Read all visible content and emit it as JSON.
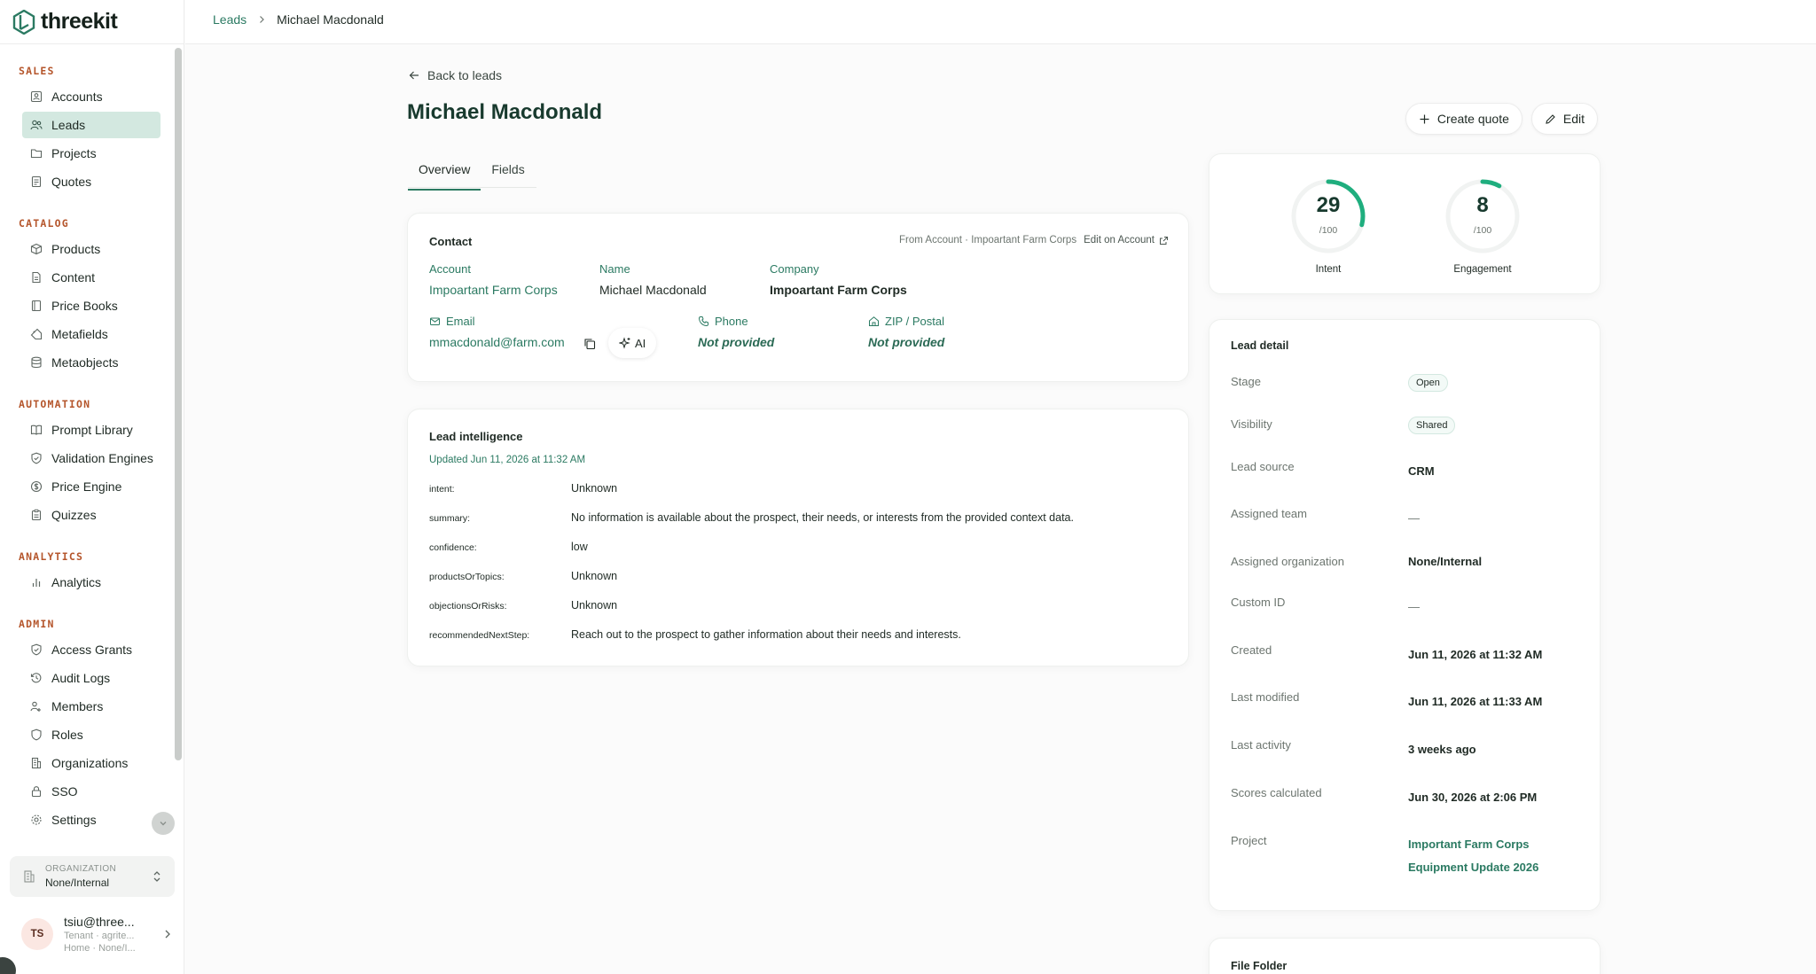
{
  "app": {
    "brand": "threekit"
  },
  "sidebar": {
    "sections": [
      {
        "title": "SALES",
        "items": [
          {
            "label": "Accounts",
            "icon": "accounts-icon"
          },
          {
            "label": "Leads",
            "icon": "users-icon",
            "active": true
          },
          {
            "label": "Projects",
            "icon": "folder-icon"
          },
          {
            "label": "Quotes",
            "icon": "document-icon"
          }
        ]
      },
      {
        "title": "CATALOG",
        "items": [
          {
            "label": "Products",
            "icon": "box-icon"
          },
          {
            "label": "Content",
            "icon": "file-icon"
          },
          {
            "label": "Price Books",
            "icon": "book-icon"
          },
          {
            "label": "Metafields",
            "icon": "tag-icon"
          },
          {
            "label": "Metaobjects",
            "icon": "database-icon"
          }
        ]
      },
      {
        "title": "AUTOMATION",
        "items": [
          {
            "label": "Prompt Library",
            "icon": "open-book-icon"
          },
          {
            "label": "Validation Engines",
            "icon": "shield-check-icon"
          },
          {
            "label": "Price Engine",
            "icon": "dollar-circle-icon"
          },
          {
            "label": "Quizzes",
            "icon": "clipboard-icon"
          }
        ]
      },
      {
        "title": "ANALYTICS",
        "items": [
          {
            "label": "Analytics",
            "icon": "bar-chart-icon"
          }
        ]
      },
      {
        "title": "ADMIN",
        "items": [
          {
            "label": "Access Grants",
            "icon": "shield-check-icon"
          },
          {
            "label": "Audit Logs",
            "icon": "history-icon"
          },
          {
            "label": "Members",
            "icon": "members-icon"
          },
          {
            "label": "Roles",
            "icon": "shield-icon"
          },
          {
            "label": "Organizations",
            "icon": "building-icon"
          },
          {
            "label": "SSO",
            "icon": "lock-icon"
          },
          {
            "label": "Settings",
            "icon": "gear-icon"
          }
        ]
      }
    ],
    "org": {
      "caption": "ORGANIZATION",
      "value": "None/Internal"
    },
    "user": {
      "initials": "TS",
      "email": "tsiu@three...",
      "tenant": "Tenant · agrite...",
      "home": "Home · None/I..."
    }
  },
  "breadcrumb": {
    "parent": "Leads",
    "current": "Michael Macdonald"
  },
  "page": {
    "back_label": "Back to leads",
    "title": "Michael Macdonald",
    "tabs": [
      {
        "label": "Overview",
        "active": true
      },
      {
        "label": "Fields",
        "active": false
      }
    ],
    "create_quote_label": "Create quote",
    "edit_label": "Edit"
  },
  "contact": {
    "title": "Contact",
    "from_account": "From Account · Impoartant Farm Corps",
    "edit_on_account": "Edit on Account",
    "account_label": "Account",
    "account_value": "Impoartant Farm Corps",
    "name_label": "Name",
    "name_value": "Michael Macdonald",
    "company_label": "Company",
    "company_value": "Impoartant Farm Corps",
    "email_label": "Email",
    "email_value": "mmacdonald@farm.com",
    "ai_label": "AI",
    "phone_label": "Phone",
    "phone_value": "Not provided",
    "zip_label": "ZIP / Postal",
    "zip_value": "Not provided"
  },
  "intelligence": {
    "title": "Lead intelligence",
    "updated": "Updated Jun 11, 2026 at 11:32 AM",
    "rows": [
      {
        "key": "intent:",
        "value": "Unknown"
      },
      {
        "key": "summary:",
        "value": "No information is available about the prospect, their needs, or interests from the provided context data."
      },
      {
        "key": "confidence:",
        "value": "low"
      },
      {
        "key": "productsOrTopics:",
        "value": "Unknown"
      },
      {
        "key": "objectionsOrRisks:",
        "value": "Unknown"
      },
      {
        "key": "recommendedNextStep:",
        "value": "Reach out to the prospect to gather information about their needs and interests."
      }
    ]
  },
  "scores": {
    "intent": {
      "value": "29",
      "max": "/100",
      "label": "Intent",
      "fraction": 0.29
    },
    "engagement": {
      "value": "8",
      "max": "/100",
      "label": "Engagement",
      "fraction": 0.08
    },
    "color": "#1fae7e"
  },
  "lead_detail": {
    "title": "Lead detail",
    "stage_label": "Stage",
    "stage_value": "Open",
    "visibility_label": "Visibility",
    "visibility_value": "Shared",
    "source_label": "Lead source",
    "source_value": "CRM",
    "team_label": "Assigned team",
    "team_value": "—",
    "org_label": "Assigned organization",
    "org_value": "None/Internal",
    "custom_label": "Custom ID",
    "custom_value": "—",
    "created_label": "Created",
    "created_value": "Jun 11, 2026 at 11:32 AM",
    "modified_label": "Last modified",
    "modified_value": "Jun 11, 2026 at 11:33 AM",
    "activity_label": "Last activity",
    "activity_value": "3 weeks ago",
    "scores_label": "Scores calculated",
    "scores_value": "Jun 30, 2026 at 2:06 PM",
    "project_label": "Project",
    "project_line1": "Important Farm Corps",
    "project_line2": "Equipment Update 2026"
  },
  "file_folder": {
    "title": "File Folder"
  },
  "colors": {
    "accent": "#2b7a62",
    "active_bg": "#d3e8e0",
    "section": "#b5562c"
  }
}
